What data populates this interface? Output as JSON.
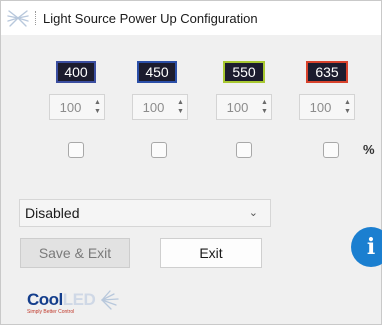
{
  "window": {
    "title": "Light Source Power Up Configuration"
  },
  "channels": [
    {
      "label": "400",
      "value": "100",
      "border": "#3b4ea0"
    },
    {
      "label": "450",
      "value": "100",
      "border": "#2b4fa8"
    },
    {
      "label": "550",
      "value": "100",
      "border": "#a8c832"
    },
    {
      "label": "635",
      "value": "100",
      "border": "#d8432d"
    }
  ],
  "percent_label": "%",
  "mode_select": {
    "selected": "Disabled"
  },
  "buttons": {
    "save_exit": "Save & Exit",
    "exit": "Exit"
  },
  "info": {
    "glyph": "i"
  },
  "brand": {
    "cool": "Cool",
    "led": "LED",
    "tagline": "Simply Better Control"
  },
  "icons": [
    "coolled-logo-icon",
    "stepper-arrows",
    "chevron-down-icon",
    "info-icon"
  ]
}
